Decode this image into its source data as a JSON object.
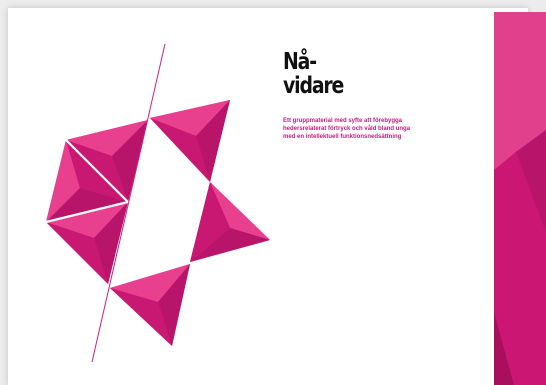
{
  "document": {
    "title_lines": [
      "Nå-",
      "vidare"
    ],
    "subtitle_lines": [
      "Ett gruppmaterial med syfte att förebygga",
      "hedersrelaterat förtryck och våld bland unga",
      "med en intellektuell funktionsnedsättning"
    ]
  },
  "colors": {
    "magenta": "#d71c7a",
    "magenta_light": "#e8408f",
    "magenta_dark": "#a80f5c",
    "title_text": "#111111",
    "subtitle_text": "#d1177a"
  }
}
